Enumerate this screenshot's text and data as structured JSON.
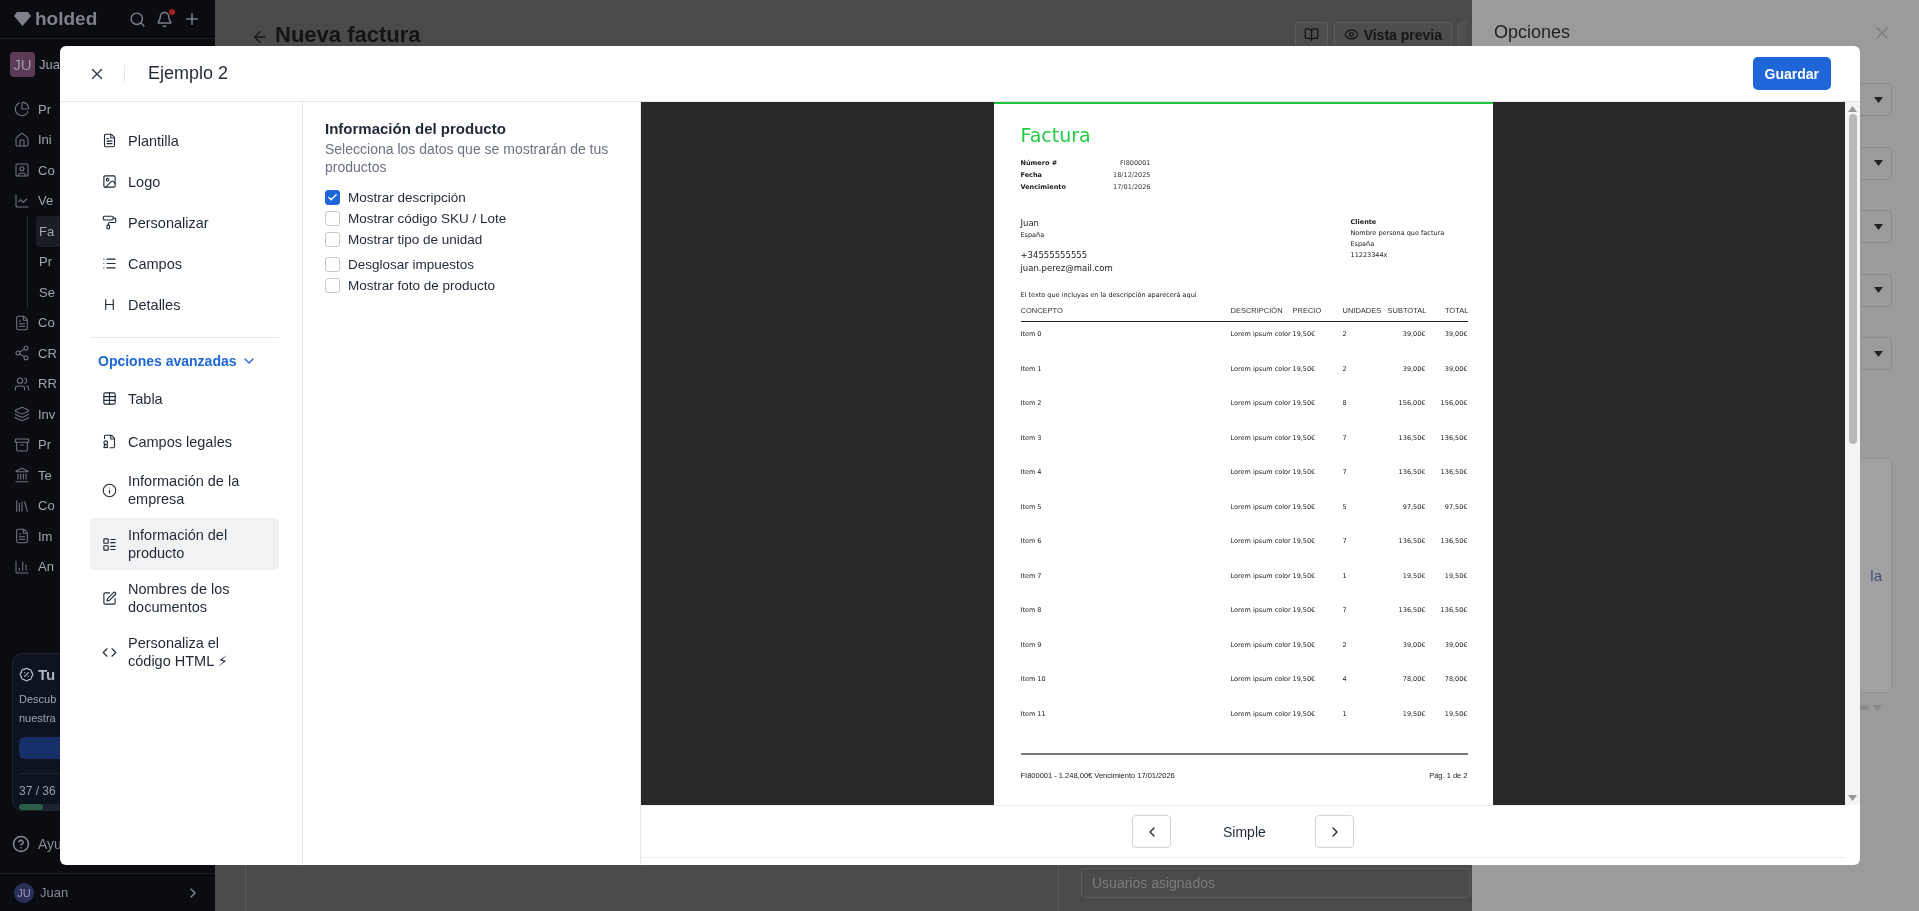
{
  "app_sidebar": {
    "logo": "holded",
    "account": {
      "initials": "JU",
      "name": "Jua"
    },
    "nav": [
      {
        "label": "Pr",
        "selected": false
      },
      {
        "label": "Ini",
        "selected": false
      },
      {
        "label": "Co",
        "selected": false
      },
      {
        "label": "Ve",
        "selected": false,
        "children": [
          {
            "label": "Fa",
            "selected": true
          },
          {
            "label": "Pr",
            "selected": false
          },
          {
            "label": "Se",
            "selected": false
          }
        ]
      },
      {
        "label": "Co",
        "selected": false
      },
      {
        "label": "CR",
        "selected": false
      },
      {
        "label": "RR",
        "selected": false
      },
      {
        "label": "Inv",
        "selected": false
      },
      {
        "label": "Pr",
        "selected": false
      },
      {
        "label": "Te",
        "selected": false
      },
      {
        "label": "Co",
        "selected": false
      },
      {
        "label": "Im",
        "selected": false
      },
      {
        "label": "An",
        "selected": false
      }
    ],
    "promo": {
      "title": "Tu",
      "lines": [
        "Descub",
        "nuestra"
      ],
      "count": "37 / 36",
      "level": 0.14
    },
    "help": "Ayu",
    "user": {
      "initials": "JU",
      "name": "Juan"
    }
  },
  "page_header": {
    "title": "Nueva factura",
    "preview_button": "Vista previa"
  },
  "assignees_field": {
    "placeholder": "Usuarios asignados"
  },
  "options_panel": {
    "title": "Opciones",
    "card_text": "la"
  },
  "modal": {
    "title": "Ejemplo 2",
    "save_button": "Guardar",
    "nav": [
      {
        "label": "Plantilla",
        "selected": false
      },
      {
        "label": "Logo",
        "selected": false
      },
      {
        "label": "Personalizar",
        "selected": false
      },
      {
        "label": "Campos",
        "selected": false
      },
      {
        "label": "Detalles",
        "selected": false
      }
    ],
    "advanced": {
      "label": "Opciones avanzadas",
      "expanded": true,
      "items": [
        {
          "label": "Tabla",
          "selected": false
        },
        {
          "label": "Campos legales",
          "selected": false
        },
        {
          "label": "Información de la empresa",
          "selected": false
        },
        {
          "label": "Información del producto",
          "selected": true
        },
        {
          "label": "Nombres de los documentos",
          "selected": false
        },
        {
          "label": "Personaliza el código HTML ⚡",
          "selected": false
        }
      ]
    },
    "section": {
      "title": "Información del producto",
      "subtitle": "Selecciona los datos que se mostrarán de tus productos",
      "option_groups": [
        {
          "options": [
            {
              "label": "Mostrar descripción",
              "checked": true
            },
            {
              "label": "Mostrar código SKU / Lote",
              "checked": false
            },
            {
              "label": "Mostrar tipo de unidad",
              "checked": false
            }
          ]
        },
        {
          "options": [
            {
              "label": "Desglosar impuestos",
              "checked": false
            },
            {
              "label": "Mostrar foto de producto",
              "checked": false
            }
          ]
        }
      ]
    },
    "preview": {
      "invoice": {
        "title": "Factura",
        "meta": [
          {
            "label": "Número #",
            "value": "FI800001"
          },
          {
            "label": "Fecha",
            "value": "18/12/2025"
          },
          {
            "label": "Vencimiento",
            "value": "17/01/2026"
          }
        ],
        "issuer": {
          "name": "Juan",
          "country": "España",
          "phone": "+34555555555",
          "email": "juan.perez@mail.com"
        },
        "client": {
          "heading": "Cliente",
          "name": "Nombre persona que factura",
          "country": "España",
          "tax_id": "11223344x"
        },
        "note": "El texto que incluyas en la descripción aparecerá aquí",
        "columns": [
          "CONCEPTO",
          "DESCRIPCIÓN",
          "PRECIO",
          "UNIDADES",
          "SUBTOTAL",
          "TOTAL"
        ],
        "rows": [
          {
            "concept": "Item 0",
            "description": "Lorem ipsum color",
            "price": "19,50€",
            "units": "2",
            "subtotal": "39,00€",
            "total": "39,00€"
          },
          {
            "concept": "Item 1",
            "description": "Lorem ipsum color",
            "price": "19,50€",
            "units": "2",
            "subtotal": "39,00€",
            "total": "39,00€"
          },
          {
            "concept": "Item 2",
            "description": "Lorem ipsum color",
            "price": "19,50€",
            "units": "8",
            "subtotal": "156,00€",
            "total": "156,00€"
          },
          {
            "concept": "Item 3",
            "description": "Lorem ipsum color",
            "price": "19,50€",
            "units": "7",
            "subtotal": "136,50€",
            "total": "136,50€"
          },
          {
            "concept": "Item 4",
            "description": "Lorem ipsum color",
            "price": "19,50€",
            "units": "7",
            "subtotal": "136,50€",
            "total": "136,50€"
          },
          {
            "concept": "Item 5",
            "description": "Lorem ipsum color",
            "price": "19,50€",
            "units": "5",
            "subtotal": "97,50€",
            "total": "97,50€"
          },
          {
            "concept": "Item 6",
            "description": "Lorem ipsum color",
            "price": "19,50€",
            "units": "7",
            "subtotal": "136,50€",
            "total": "136,50€"
          },
          {
            "concept": "Item 7",
            "description": "Lorem ipsum color",
            "price": "19,50€",
            "units": "1",
            "subtotal": "19,50€",
            "total": "19,50€"
          },
          {
            "concept": "Item 8",
            "description": "Lorem ipsum color",
            "price": "19,50€",
            "units": "7",
            "subtotal": "136,50€",
            "total": "136,50€"
          },
          {
            "concept": "Item 9",
            "description": "Lorem ipsum color",
            "price": "19,50€",
            "units": "2",
            "subtotal": "39,00€",
            "total": "39,00€"
          },
          {
            "concept": "Item 10",
            "description": "Lorem ipsum color",
            "price": "19,50€",
            "units": "4",
            "subtotal": "78,00€",
            "total": "78,00€"
          },
          {
            "concept": "Item 11",
            "description": "Lorem ipsum color",
            "price": "19,50€",
            "units": "1",
            "subtotal": "19,50€",
            "total": "19,50€"
          }
        ],
        "footer_left": "FI800001 - 1.248,00€ Vencimiento 17/01/2026",
        "footer_right": "Pág. 1 de 2"
      },
      "pager": {
        "label": "Simple"
      }
    }
  }
}
